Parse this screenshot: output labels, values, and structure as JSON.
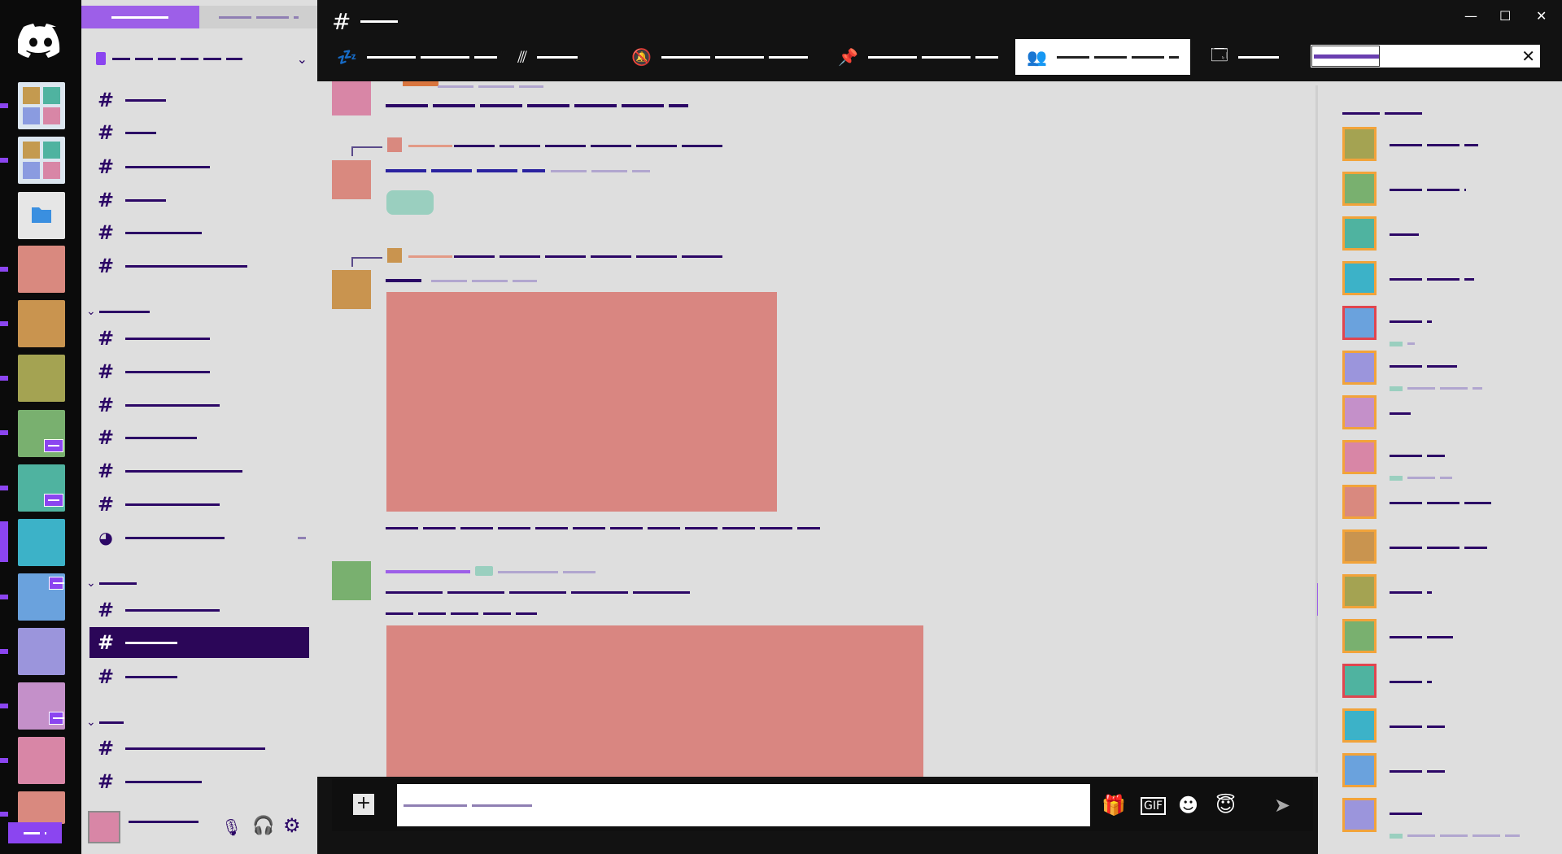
{
  "app": {
    "title": "Discord"
  },
  "rail": {
    "colors": [
      "#d9897f",
      "#c9944f",
      "#a4a352",
      "#79b06f",
      "#4fb3a0",
      "#3cb2c8",
      "#6aa2dd",
      "#9b95dc",
      "#c490c9",
      "#d886a6",
      "#d9897f"
    ],
    "folder_icon": "folder-icon",
    "mosaic_colors": [
      "#c49a4f",
      "#4fb3a0",
      "#8a9be0",
      "#d886a6"
    ]
  },
  "sidebar": {
    "tabs": [
      "■■■■■■■■■■■■",
      "■■■■■■■ ■■■■■■■■■"
    ],
    "guild_name": "■■■■ ■■■■■■■■■ ■■■■■■■■■■",
    "channels_top": [
      "■■■■■■■■■■",
      "■■■■■■■■",
      "■■■■■■■■■■■■■■■■■",
      "■■■■■■■■■■",
      "■■■■■■■■■■■■■■■■■",
      "■■■■■■■■■■■■■■■■■■■■■■■■"
    ],
    "category_1": "■■■■■■■■■■■■",
    "channels_mid": [
      "■■■■■■■■■■■■■■■■",
      "■■■■■■■■■■■■■■■■",
      "■■■■■■■■■■■■■■■■■■",
      "■■■■■■■■■■■■■■",
      "■■■■■■■■■■■■■■■■■■■■■■",
      "■■■■■■■■■■■■■■■■■■",
      "■■■■■■■■■■■■■■■■■■■■"
    ],
    "category_2": "■■■■■■■■■",
    "channels_low": [
      "■■■■■■■■■■■■■■■■■■",
      "■■■■■■■■■■■■",
      "■■■■■■■■■■"
    ],
    "category_3": "■■■■■",
    "channels_bottom": [
      "■■■■■■■■■■■■■■■■■■■■■■■■■■",
      "■■■■■■■■■■■■■■■"
    ],
    "user_name": "■■■■■■■■■■■■■■",
    "thread_badge": "■■"
  },
  "topbar": {
    "channel_name": "■■■■■■■■■■■■",
    "tools": [
      "■■■■■■■■■■■ ■■■■■■■■■■■",
      "■■■■■■■■■■",
      "■■■■■■■■■■■ ■■■■■■■■■■■",
      "■■■■■■■■■ ■■■■■■■■■■■■",
      "■■■■■■ ■■■■■■■■■ ■■■■■",
      "■■■■■■■■■"
    ],
    "search_value": "■■■■■■■■■■■"
  },
  "messages": {
    "m1_text": "■■■■■■■■ ■■■■■■■■■■■ ■■■■■■■■■■■■■ ■■■■ ■■■■■■■■■■■■■■■",
    "m1_meta": "■■■■■■■■■■■■ ■■■■■■",
    "m2_reply": "■■■■■■■■■■ ■■■■■■■■■■ ■■■■■■■■■■■■ ■■■■ ■■■■■■■■■■■■■",
    "m2_user": "■■■■■■■■■ ■■■■■ ■■■■■■■■■■■■■■",
    "m2_meta": "■■■■■■■■■■■■■ ■■■■■■",
    "m3_reply": "■■■■■■■■■■ ■■■■■■■■■■ ■■■■■■■■■■■■ ■■■■ ■■■■■■■■■■■■■",
    "m3_user": "■■■■■■■■■",
    "m3_meta": "■■■■■■■■■■■■■ ■■■■■■",
    "m3_caption": "■ ■■■■■■ ■■■■■■■■■■■ ■■■ ■■■■■■■■■ ■■■■■■ ■■■■ ■■■■■■■■■ ■■■■■■■■■ ■■■■■■■■■ ■■ ■■■■■■",
    "m4_user": "■■■■■■■■■■■■■■■■■■",
    "m4_meta": "■■■■■■■■■■■■ ■■■■■■",
    "m4_line1": "■■■■■■■■■■■■■ ■■■ ■■■■■ ■■■■■ ■■■■■■■■ ■■■■■■■ ■■■■■■■■■ ■■■■■■",
    "m4_line2": "■■■■■■ ■■■■■■ ■■■■■■ ■■ ■■■■■",
    "composer_placeholder": "■■■■■■■■■■■■■■ ■■■■■■■■■■■"
  },
  "members": {
    "header": "■■■■■■■■■ ■ ■■■■■",
    "list": [
      {
        "name": "■■ ■■■■■■■■■■■■ ■■■■■",
        "sub": ""
      },
      {
        "name": "■■ ■■■■■■■■■ ■■■■■",
        "sub": ""
      },
      {
        "name": "■■■■■■■",
        "sub": ""
      },
      {
        "name": "■■■■■■■■■■■■■■■■■■■■",
        "sub": ""
      },
      {
        "name": "■■■■■■■■■■",
        "sub": "■■"
      },
      {
        "name": "■■■■■■■■■■■■■■■■",
        "sub": "■■■■■■■■■■ ■■■■■■■■■"
      },
      {
        "name": "■■■■■",
        "sub": ""
      },
      {
        "name": "■■■■■■■■■■■■■",
        "sub": "■■■■■■ ■■■■■"
      },
      {
        "name": "■■■■■■■■■ ■■ ■■■■■■■■■■■",
        "sub": ""
      },
      {
        "name": "■■■■■■■■■■■■■■■■■■■■■■■",
        "sub": ""
      },
      {
        "name": "■■■■■■■■■■",
        "sub": ""
      },
      {
        "name": "■■■■■■■■■■■■■■■",
        "sub": ""
      },
      {
        "name": "■■■■■■■■■■",
        "sub": ""
      },
      {
        "name": "■■■■■■■■■■■■■",
        "sub": ""
      },
      {
        "name": "■■■■■■■■■■■■■",
        "sub": ""
      },
      {
        "name": "■■■■■■■■",
        "sub": "■■■■■■ ■■■■■ ■■■■■ ■■■■■■■■■■■"
      }
    ],
    "avatar_colors": [
      "#a4a352",
      "#79b06f",
      "#4fb3a0",
      "#3cb2c8",
      "#6aa2dd",
      "#9b95dc",
      "#c490c9",
      "#d886a6",
      "#d9897f",
      "#c9944f",
      "#a4a352",
      "#79b06f",
      "#4fb3a0",
      "#3cb2c8",
      "#6aa2dd",
      "#9b95dc"
    ]
  },
  "colors": {
    "accent": "#8b45f0",
    "selected": "#2b0658",
    "text": "#2c0766",
    "panel": "#dedede",
    "dark": "#121212"
  }
}
